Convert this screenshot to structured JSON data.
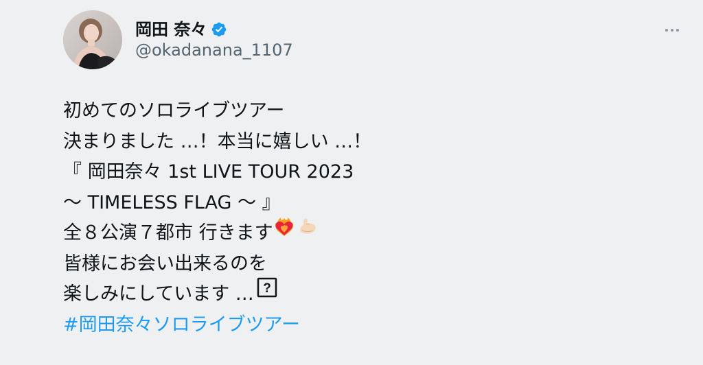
{
  "author": {
    "display_name": "岡田 奈々",
    "handle": "@okadanana_1107",
    "verified": true,
    "avatar_icon": "avatar-photo"
  },
  "more_icon": "more-horizontal-icon",
  "tweet": {
    "lines": [
      "初めてのソロライブツアー",
      "決まりました …！本当に嬉しい …！",
      "『 岡田奈々 1st LIVE TOUR 2023",
      "〜 TIMELESS FLAG 〜 』",
      "全８公演７都市 行きます",
      "皆様にお会い出来るのを",
      "楽しみにしています …"
    ],
    "line5_emojis": [
      "heart-on-fire-emoji",
      "flexed-biceps-emoji"
    ],
    "line7_glyph": "question-box-icon",
    "hashtag": "#岡田奈々ソロライブツアー"
  },
  "colors": {
    "background": "#eef0f2",
    "text": "#0f1419",
    "secondary": "#536471",
    "link": "#1d9bf0",
    "verified": "#1d9bf0"
  }
}
